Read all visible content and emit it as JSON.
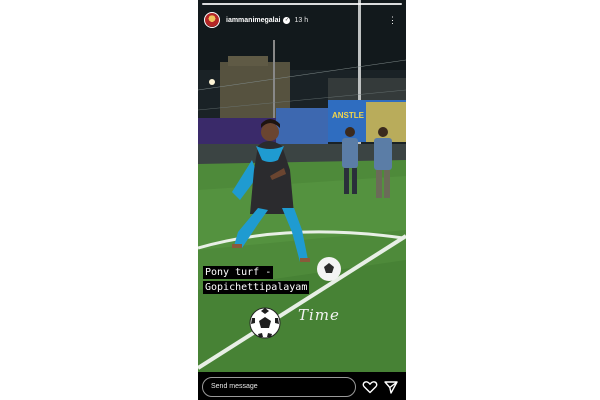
{
  "story": {
    "username": "iammanimegalai",
    "time": "13 h",
    "more_icon": "⋮",
    "caption_line1": "Pony turf -",
    "caption_line2": "Gopichettipalayam",
    "sticker_text": "Time",
    "message_placeholder": "Send message"
  },
  "colors": {
    "turf": "#4e8a3a",
    "dupatta": "#1f9bd1",
    "sky": "#1a2226"
  }
}
